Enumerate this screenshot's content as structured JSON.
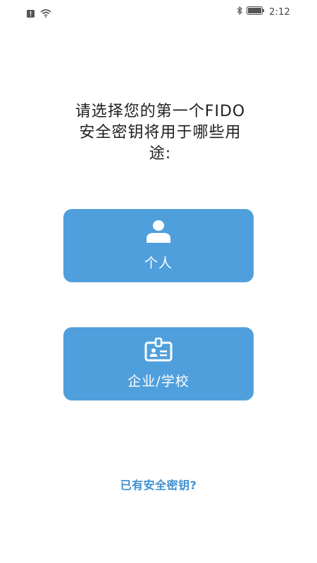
{
  "status_bar": {
    "time": "2:12",
    "left_icons": [
      "notification-icon",
      "wifi-icon"
    ],
    "right_icons": [
      "bluetooth-icon",
      "battery-icon"
    ]
  },
  "question": {
    "line1": "请选择您的第一个FIDO",
    "line2": "安全密钥将用于哪些用",
    "line3": "途:"
  },
  "choices": {
    "personal": {
      "label": "个人",
      "icon": "person-icon"
    },
    "enterprise": {
      "label": "企业/学校",
      "icon": "id-badge-icon"
    }
  },
  "link": {
    "label": "已有安全密钥?"
  },
  "colors": {
    "card": "#4f9fdc",
    "link": "#3d8fd0",
    "text": "#1e1e1e",
    "background": "#ffffff"
  }
}
